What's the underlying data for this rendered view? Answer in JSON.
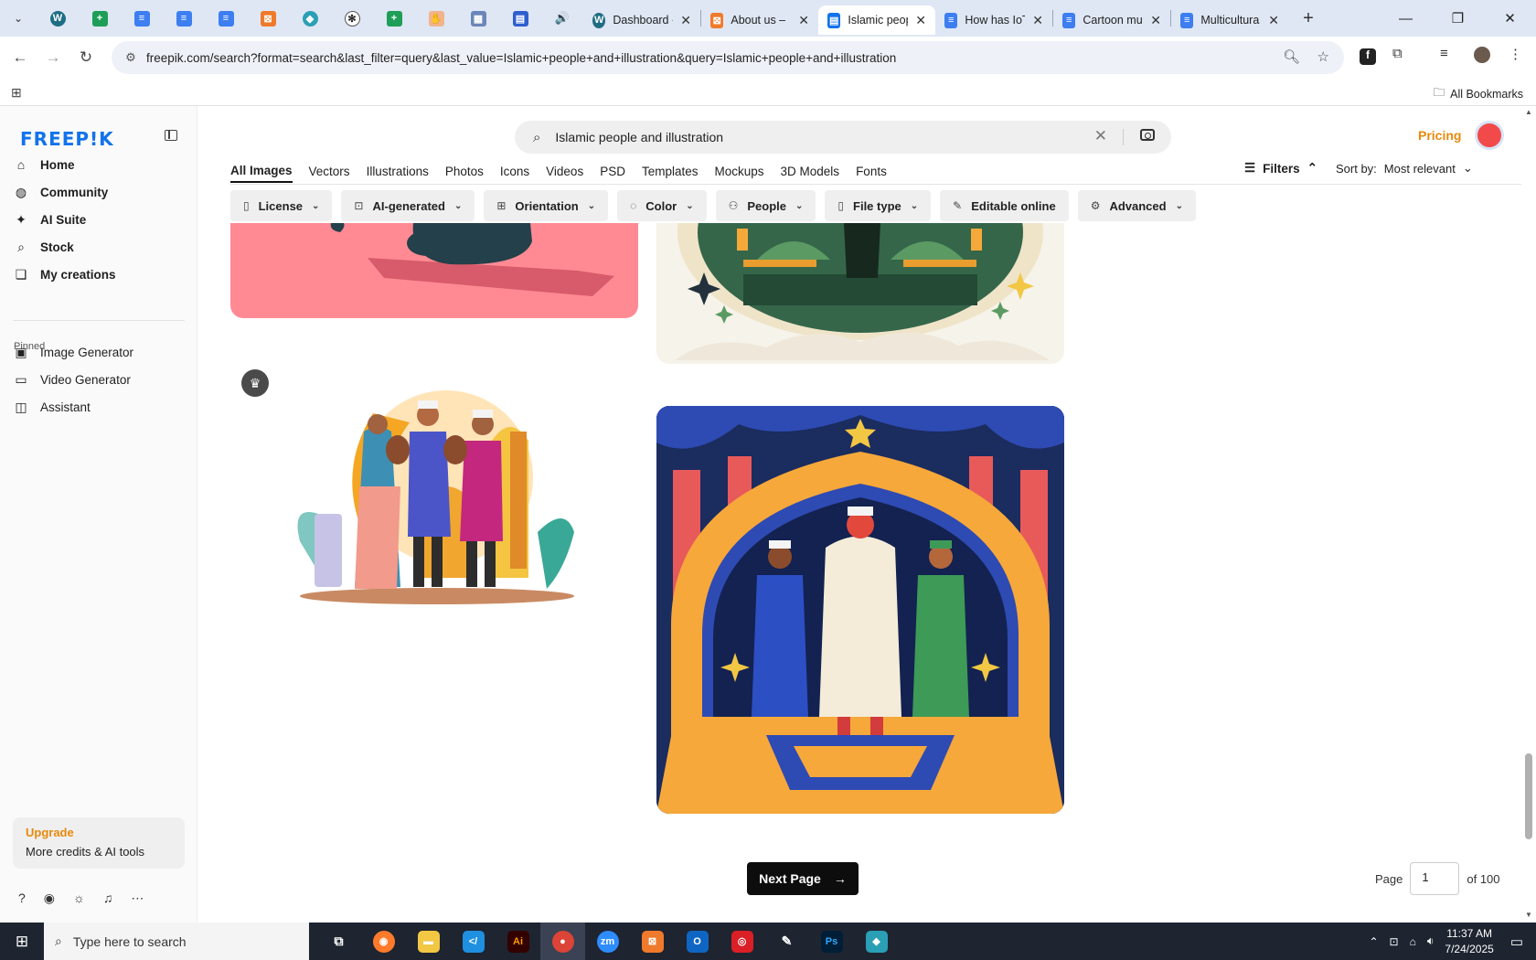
{
  "browser": {
    "tabs": [
      {
        "title": "Dashboard ‹",
        "icon": "wordpress-icon",
        "active": false
      },
      {
        "title": "About us – ",
        "icon": "xampp-icon",
        "active": false
      },
      {
        "title": "Islamic peop",
        "icon": "freepik-icon",
        "active": true
      },
      {
        "title": "How has IoT",
        "icon": "docs-icon",
        "active": false
      },
      {
        "title": "Cartoon mu",
        "icon": "docs-icon",
        "active": false
      },
      {
        "title": "Multicultura",
        "icon": "docs-icon",
        "active": false
      }
    ],
    "url": "freepik.com/search?format=search&last_filter=query&last_value=Islamic+people+and+illustration&query=Islamic+people+and+illustration",
    "all_bookmarks": "All Bookmarks"
  },
  "sidebar": {
    "logo": "FREEP!K",
    "nav": [
      {
        "label": "Home",
        "icon": "home-icon"
      },
      {
        "label": "Community",
        "icon": "globe-icon"
      },
      {
        "label": "AI Suite",
        "icon": "sparkle-icon"
      },
      {
        "label": "Stock",
        "icon": "search-icon"
      },
      {
        "label": "My creations",
        "icon": "folder-icon"
      }
    ],
    "pinned_label": "Pinned",
    "pinned": [
      {
        "label": "Image Generator",
        "icon": "image-icon"
      },
      {
        "label": "Video Generator",
        "icon": "video-icon"
      },
      {
        "label": "Assistant",
        "icon": "chat-icon"
      }
    ],
    "upgrade": {
      "title": "Upgrade",
      "subtitle": "More credits & AI tools"
    }
  },
  "search": {
    "value": "Islamic people and illustration"
  },
  "header": {
    "pricing": "Pricing"
  },
  "type_tabs": [
    "All Images",
    "Vectors",
    "Illustrations",
    "Photos",
    "Icons",
    "Videos",
    "PSD",
    "Templates",
    "Mockups",
    "3D Models",
    "Fonts"
  ],
  "filters_label": "Filters",
  "sort": {
    "label": "Sort by:",
    "value": "Most relevant"
  },
  "chips": [
    {
      "label": "License",
      "icon": "license-icon"
    },
    {
      "label": "AI-generated",
      "icon": "ai-icon"
    },
    {
      "label": "Orientation",
      "icon": "orientation-icon"
    },
    {
      "label": "Color",
      "icon": "palette-icon"
    },
    {
      "label": "People",
      "icon": "people-icon"
    },
    {
      "label": "File type",
      "icon": "file-icon"
    },
    {
      "label": "Editable online",
      "icon": "pen-icon"
    },
    {
      "label": "Advanced",
      "icon": "gear-icon"
    }
  ],
  "pagination": {
    "next_label": "Next Page",
    "page_label": "Page",
    "current_page": "1",
    "of_label": "of 100"
  },
  "taskbar": {
    "search_placeholder": "Type here to search",
    "time": "11:37 AM",
    "date": "7/24/2025"
  },
  "colors": {
    "brand": "#1273eb",
    "accent": "#e8890c"
  }
}
